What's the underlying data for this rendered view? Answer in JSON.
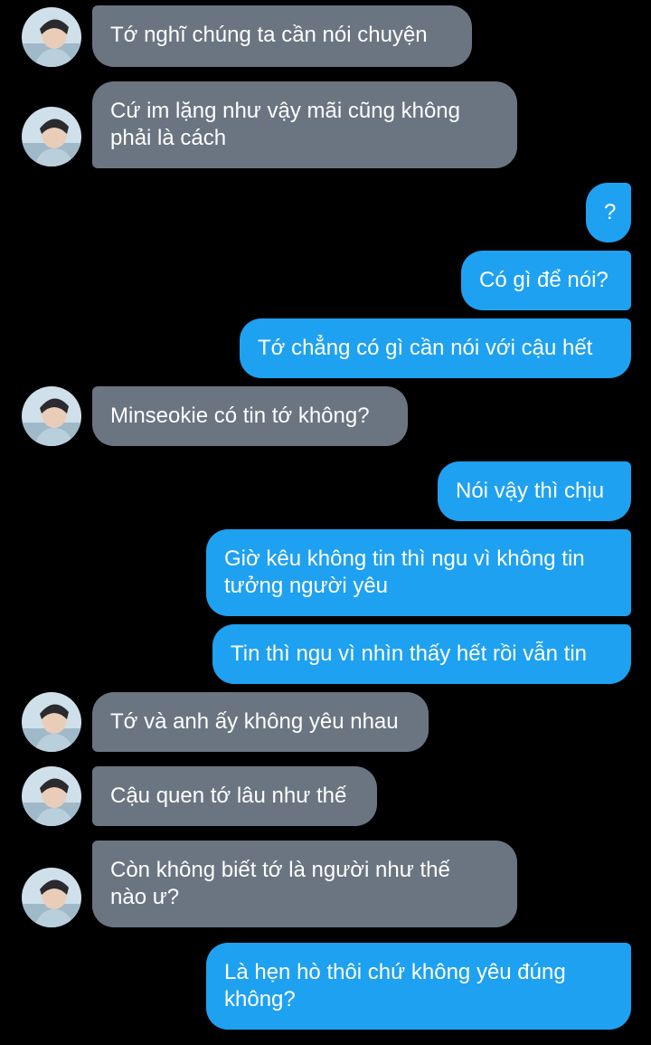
{
  "conversation": {
    "messages": [
      {
        "direction": "in",
        "text": "Tớ nghĩ chúng ta cần nói chuyện",
        "avatar": "contact-avatar"
      },
      {
        "direction": "in",
        "text": "Cứ im lặng như vậy mãi cũng không\nphải là cách",
        "avatar": "contact-avatar"
      },
      {
        "direction": "out",
        "text": "?"
      },
      {
        "direction": "out",
        "text": "Có gì để nói?"
      },
      {
        "direction": "out",
        "text": "Tớ chẳng có gì cần nói với cậu hết"
      },
      {
        "direction": "in",
        "text": "Minseokie có tin tớ không?",
        "avatar": "contact-avatar"
      },
      {
        "direction": "out",
        "text": "Nói vậy thì chịu"
      },
      {
        "direction": "out",
        "text": "Giờ kêu không tin thì ngu vì không tin\ntưởng người yêu"
      },
      {
        "direction": "out",
        "text": "Tin thì ngu vì nhìn thấy hết rồi vẫn tin"
      },
      {
        "direction": "in",
        "text": "Tớ và anh ấy không yêu nhau",
        "avatar": "contact-avatar"
      },
      {
        "direction": "in",
        "text": "Cậu quen tớ lâu như thế",
        "avatar": "contact-avatar"
      },
      {
        "direction": "in",
        "text": "Còn không biết tớ là người như thế\nnào ư?",
        "avatar": "contact-avatar"
      },
      {
        "direction": "out",
        "text": "Là hẹn hò thôi chứ không yêu đúng\nkhông?"
      }
    ]
  },
  "colors": {
    "background": "#000000",
    "incoming_bubble": "#6b7582",
    "outgoing_bubble": "#1ea1f1",
    "text": "#ffffff"
  }
}
